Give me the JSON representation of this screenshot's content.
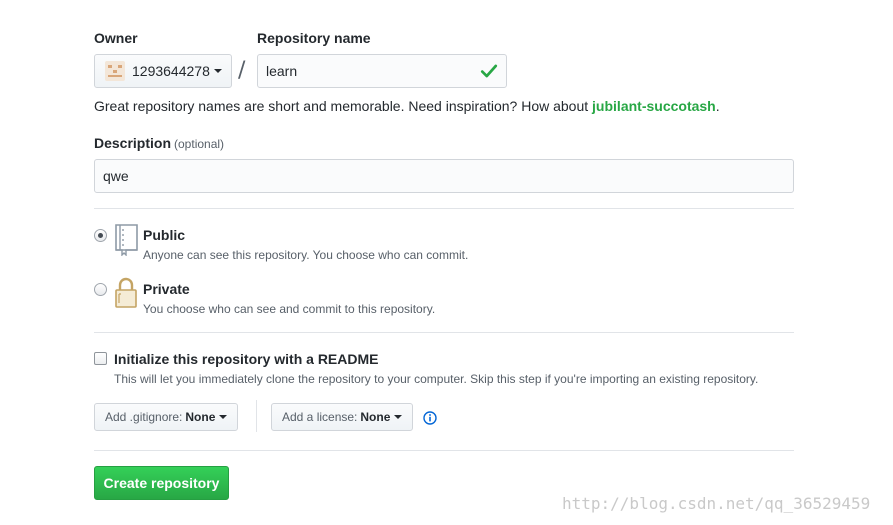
{
  "owner": {
    "label": "Owner",
    "value": "1293644278"
  },
  "repository": {
    "label": "Repository name",
    "value": "learn",
    "status_icon": "check-icon",
    "separator": "/"
  },
  "name_hint": {
    "text": "Great repository names are short and memorable. Need inspiration? How about ",
    "suggestion": "jubilant-succotash",
    "end": "."
  },
  "description": {
    "label": "Description",
    "optional": "(optional)",
    "value": "qwe"
  },
  "visibility": {
    "selected": "public",
    "public": {
      "title": "Public",
      "note": "Anyone can see this repository. You choose who can commit.",
      "icon": "repo-book-icon"
    },
    "private": {
      "title": "Private",
      "note": "You choose who can see and commit to this repository.",
      "icon": "lock-icon"
    }
  },
  "init_readme": {
    "checked": false,
    "label": "Initialize this repository with a README",
    "note": "This will let you immediately clone the repository to your computer. Skip this step if you're importing an existing repository."
  },
  "gitignore": {
    "label": "Add .gitignore:",
    "value": "None"
  },
  "license": {
    "label": "Add a license:",
    "value": "None"
  },
  "info_icon": "info-icon",
  "submit": {
    "label": "Create repository"
  },
  "watermark": "http://blog.csdn.net/qq_36529459",
  "colors": {
    "accent_green": "#28a745",
    "text": "#24292e",
    "muted": "#586069",
    "info_blue": "#0366d6"
  }
}
